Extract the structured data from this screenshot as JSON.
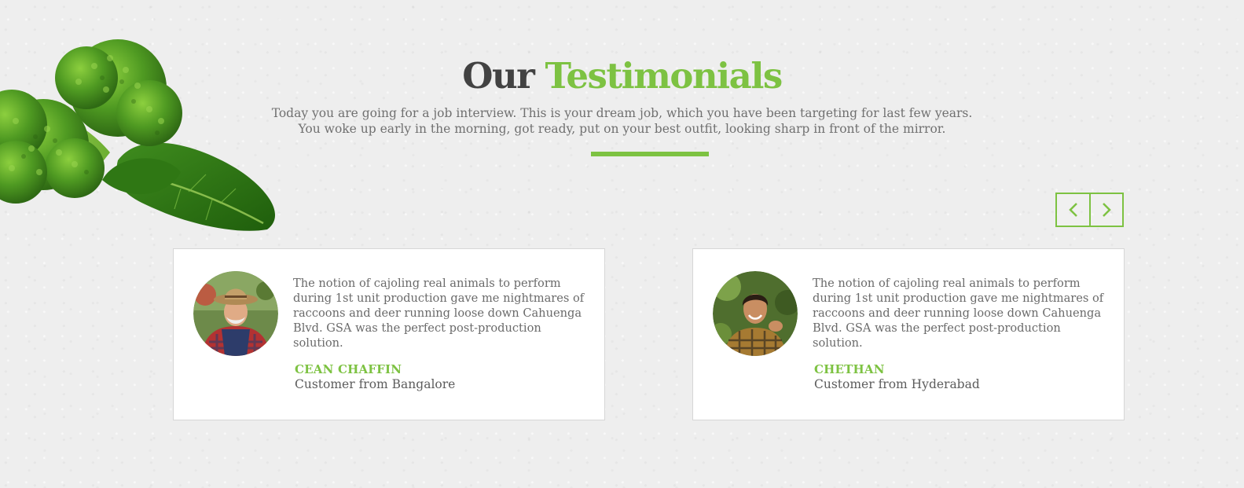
{
  "header": {
    "title_part1": "Our",
    "title_part2": "Testimonials",
    "subtitle_line1": "Today you are going for a job interview. This is your dream job, which you have been targeting for last few years.",
    "subtitle_line2": "You woke up early in the morning, got ready, put on your best outfit, looking sharp in front of the mirror."
  },
  "nav": {
    "prev_icon": "chevron-left-icon",
    "next_icon": "chevron-right-icon"
  },
  "colors": {
    "accent": "#7dc242",
    "heading": "#424242",
    "text": "#6a6a6a"
  },
  "testimonials": [
    {
      "quote": "The notion of cajoling real animals to perform during 1st unit production gave me nightmares of raccoons and deer running loose down Cahuenga Blvd. GSA was the perfect post-production solution.",
      "name": "CEAN CHAFFIN",
      "location": "Customer from Bangalore"
    },
    {
      "quote": "The notion of cajoling real animals to perform during 1st unit production gave me nightmares of raccoons and deer running loose down Cahuenga Blvd. GSA was the perfect post-production solution.",
      "name": "CHETHAN",
      "location": "Customer from Hyderabad"
    }
  ]
}
